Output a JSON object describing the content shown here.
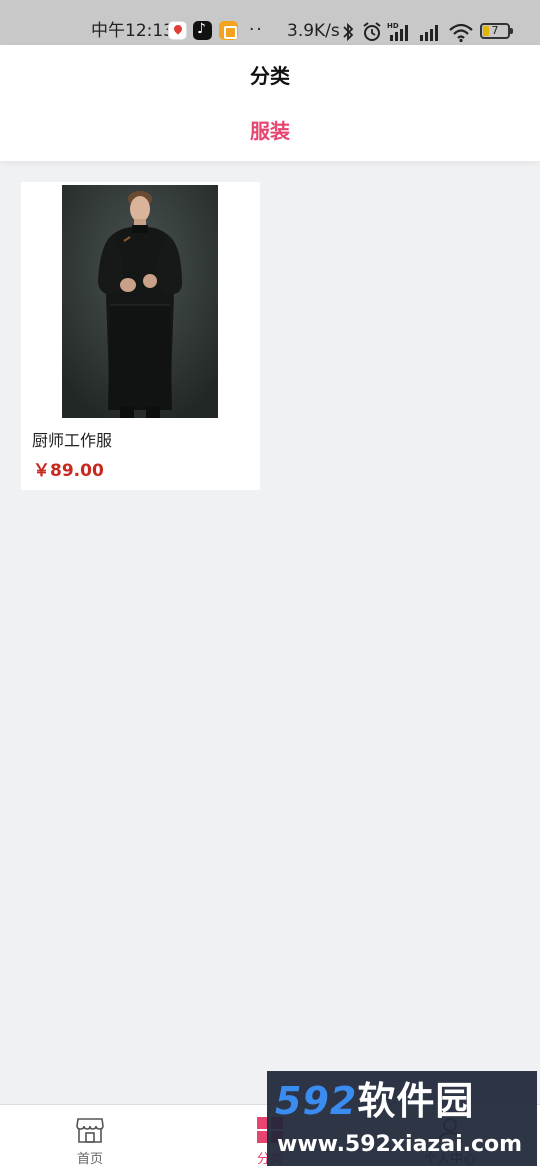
{
  "status_bar": {
    "time": "中午12:13",
    "notification_icons": [
      "map-pin-icon",
      "tiktok-icon",
      "notes-icon"
    ],
    "dots": "··",
    "network_speed": "3.9K/s",
    "system_icons": [
      "bluetooth-icon",
      "alarm-icon",
      "hd-signal-icon",
      "signal-icon",
      "wifi-icon"
    ],
    "battery_level": "7"
  },
  "header": {
    "title": "分类",
    "active_category": "服装",
    "accent_color": "#e64570"
  },
  "products": [
    {
      "name": "厨师工作服",
      "price": "￥89.00",
      "image": "chef-uniform-photo",
      "price_color": "#c8281e"
    }
  ],
  "tab_bar": {
    "items": [
      {
        "label": "首页",
        "icon": "store-icon",
        "active": false
      },
      {
        "label": "分类",
        "icon": "category-grid-icon",
        "active": true
      },
      {
        "label": "个人中心",
        "icon": "user-icon",
        "active": false
      }
    ]
  },
  "watermark": {
    "brand_digits": "592",
    "brand_text": "软件园",
    "url": "www.592xiazai.com"
  }
}
